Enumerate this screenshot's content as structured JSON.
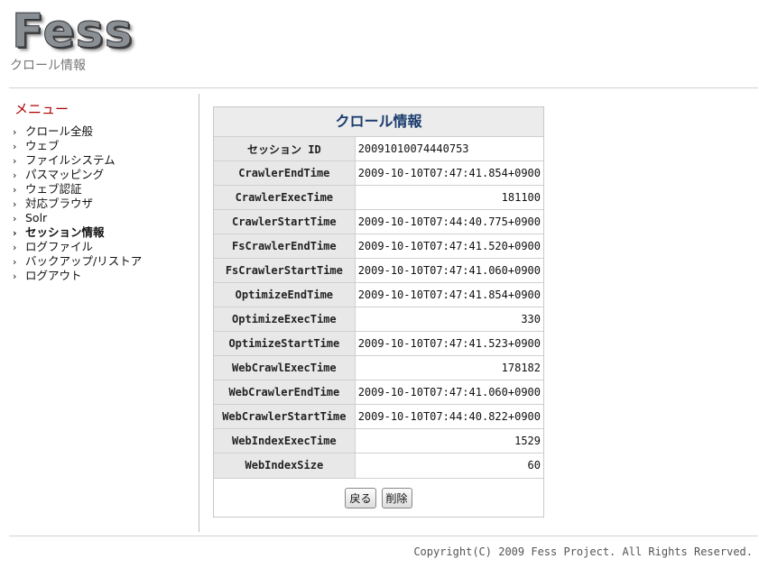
{
  "header": {
    "logo_text": "Fess",
    "page_subtitle": "クロール情報"
  },
  "sidebar": {
    "title": "メニュー",
    "chevron": "›",
    "items": [
      {
        "label": "クロール全般"
      },
      {
        "label": "ウェブ"
      },
      {
        "label": "ファイルシステム"
      },
      {
        "label": "パスマッピング"
      },
      {
        "label": "ウェブ認証"
      },
      {
        "label": "対応ブラウザ"
      },
      {
        "label": "Solr"
      },
      {
        "label": "セッション情報",
        "active": true
      },
      {
        "label": "ログファイル"
      },
      {
        "label": "バックアップ/リストア"
      },
      {
        "label": "ログアウト"
      }
    ]
  },
  "panel": {
    "title": "クロール情報",
    "rows": [
      {
        "key": "セッション ID",
        "value": "20091010074440753"
      },
      {
        "key": "CrawlerEndTime",
        "value": "2009-10-10T07:47:41.854+0900"
      },
      {
        "key": "CrawlerExecTime",
        "value": "181100"
      },
      {
        "key": "CrawlerStartTime",
        "value": "2009-10-10T07:44:40.775+0900"
      },
      {
        "key": "FsCrawlerEndTime",
        "value": "2009-10-10T07:47:41.520+0900"
      },
      {
        "key": "FsCrawlerStartTime",
        "value": "2009-10-10T07:47:41.060+0900"
      },
      {
        "key": "OptimizeEndTime",
        "value": "2009-10-10T07:47:41.854+0900"
      },
      {
        "key": "OptimizeExecTime",
        "value": "330"
      },
      {
        "key": "OptimizeStartTime",
        "value": "2009-10-10T07:47:41.523+0900"
      },
      {
        "key": "WebCrawlExecTime",
        "value": "178182"
      },
      {
        "key": "WebCrawlerEndTime",
        "value": "2009-10-10T07:47:41.060+0900"
      },
      {
        "key": "WebCrawlerStartTime",
        "value": "2009-10-10T07:44:40.822+0900"
      },
      {
        "key": "WebIndexExecTime",
        "value": "1529"
      },
      {
        "key": "WebIndexSize",
        "value": "60"
      }
    ],
    "back_button": "戻る",
    "delete_button": "削除"
  },
  "footer": {
    "copyright": "Copyright(C) 2009 Fess Project. All Rights Reserved."
  }
}
